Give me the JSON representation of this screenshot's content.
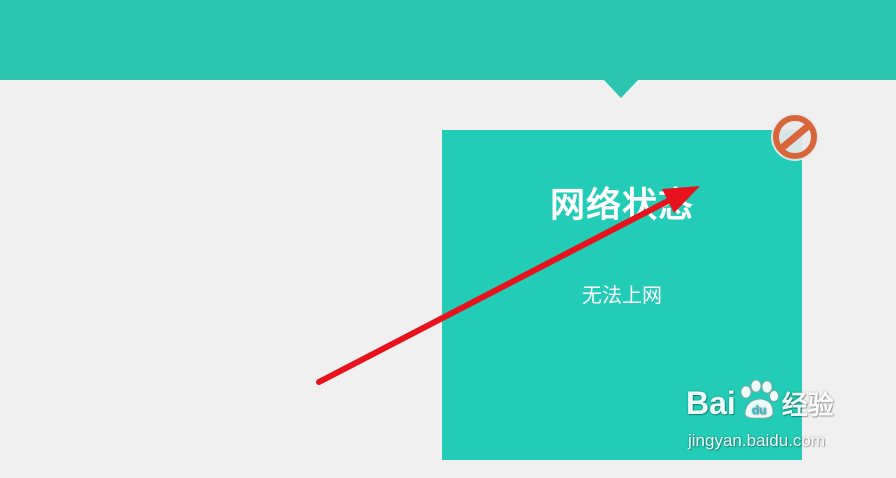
{
  "card": {
    "title": "网络状态",
    "status": "无法上网"
  },
  "icons": {
    "status_icon": "no-entry-icon",
    "annotation": "red-arrow"
  },
  "watermark": {
    "brand_bai": "Bai",
    "brand_jingyan": "经验",
    "url": "jingyan.baidu.com"
  },
  "colors": {
    "banner": "#2bc4ae",
    "card": "#22ccb6",
    "background": "#f0f0f0",
    "no_entry_icon": "#d9663a",
    "arrow": "#e8121c"
  }
}
